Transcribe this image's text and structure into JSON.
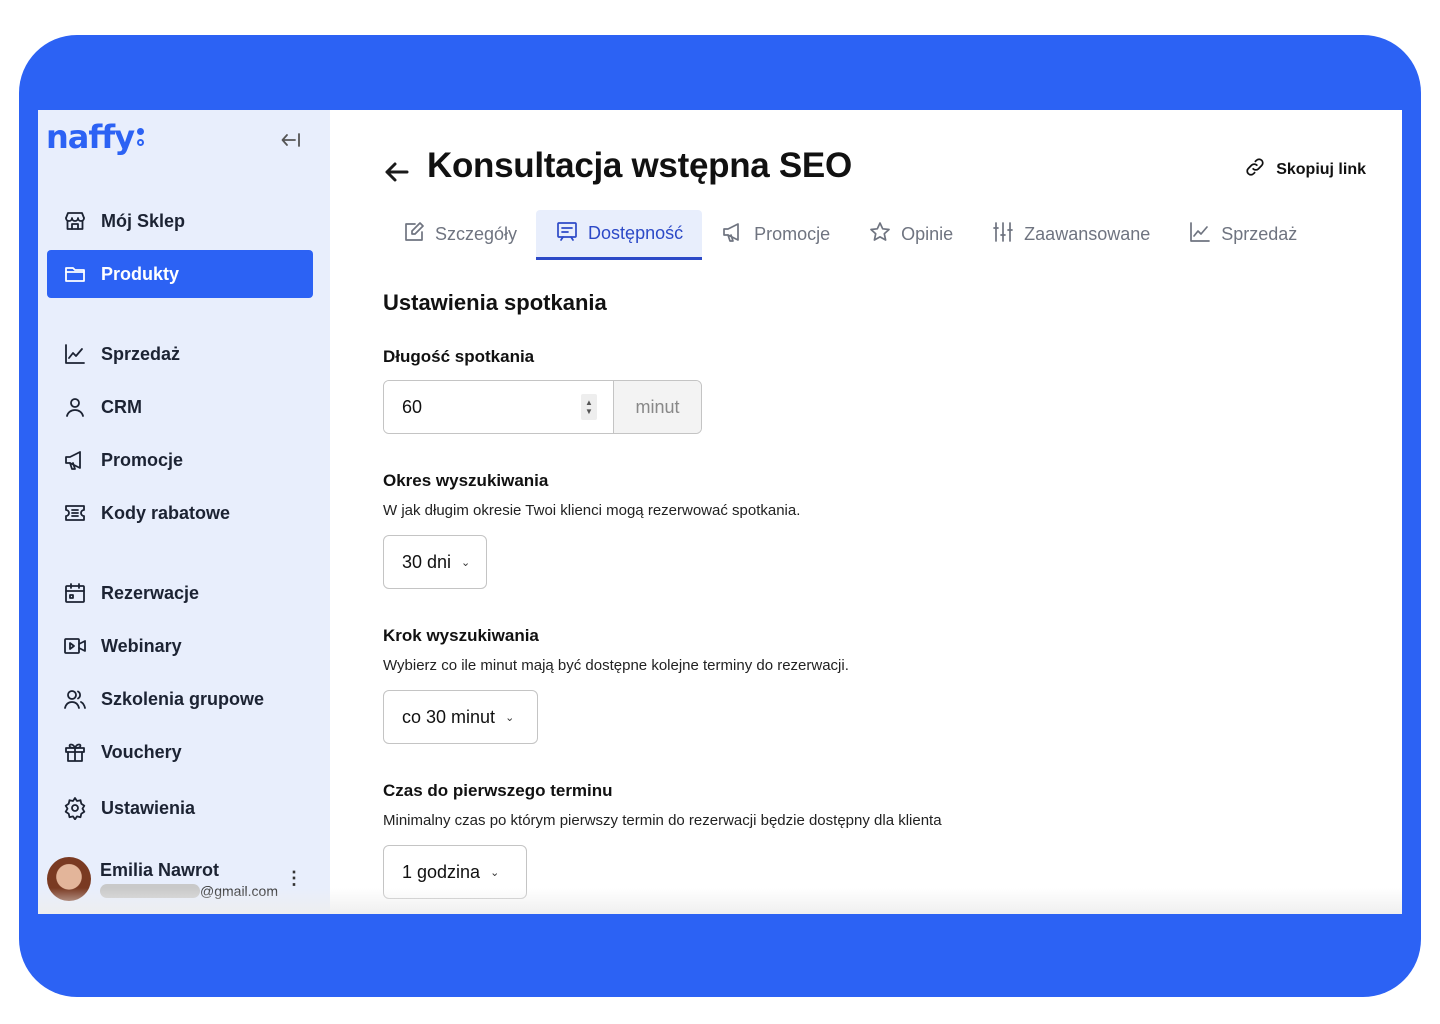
{
  "brand": {
    "logo_text": "naffy",
    "accent": "#2c62f4"
  },
  "sidebar": {
    "collapse_icon": "collapse-left-icon",
    "items": [
      {
        "label": "Mój Sklep",
        "icon": "store-icon"
      },
      {
        "label": "Produkty",
        "icon": "folder-icon",
        "active": true
      },
      {
        "label": "Sprzedaż",
        "icon": "chart-line-icon"
      },
      {
        "label": "CRM",
        "icon": "user-icon"
      },
      {
        "label": "Promocje",
        "icon": "megaphone-icon"
      },
      {
        "label": "Kody rabatowe",
        "icon": "ticket-icon"
      },
      {
        "label": "Rezerwacje",
        "icon": "calendar-icon"
      },
      {
        "label": "Webinary",
        "icon": "video-icon"
      },
      {
        "label": "Szkolenia grupowe",
        "icon": "users-icon"
      },
      {
        "label": "Vouchery",
        "icon": "gift-icon"
      },
      {
        "label": "Ustawienia",
        "icon": "gear-icon"
      }
    ],
    "user": {
      "name": "Emilia Nawrot",
      "email_suffix": "@gmail.com",
      "menu_icon": "more-vertical-icon"
    }
  },
  "header": {
    "back_icon": "arrow-left-icon",
    "title": "Konsultacja wstępna SEO",
    "copy_link_label": "Skopiuj link",
    "copy_link_icon": "link-icon"
  },
  "tabs": [
    {
      "label": "Szczegóły",
      "icon": "edit-icon"
    },
    {
      "label": "Dostępność",
      "icon": "presentation-icon",
      "active": true
    },
    {
      "label": "Promocje",
      "icon": "megaphone-icon"
    },
    {
      "label": "Opinie",
      "icon": "star-icon"
    },
    {
      "label": "Zaawansowane",
      "icon": "sliders-icon"
    },
    {
      "label": "Sprzedaż",
      "icon": "chart-line-icon"
    }
  ],
  "form": {
    "section_title": "Ustawienia spotkania",
    "duration": {
      "label": "Długość spotkania",
      "value": "60",
      "unit": "minut"
    },
    "search_period": {
      "label": "Okres wyszukiwania",
      "description": "W jak długim okresie Twoi klienci mogą rezerwować spotkania.",
      "value": "30 dni"
    },
    "search_step": {
      "label": "Krok wyszukiwania",
      "description": "Wybierz co ile minut mają być dostępne kolejne terminy do rezerwacji.",
      "value": "co 30 minut"
    },
    "first_slot": {
      "label": "Czas do pierwszego terminu",
      "description": "Minimalny czas po którym pierwszy termin do rezerwacji będzie dostępny dla klienta",
      "value": "1 godzina"
    }
  }
}
